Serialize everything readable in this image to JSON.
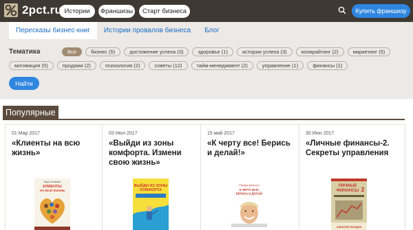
{
  "header": {
    "logo_text": "2pct.ru",
    "nav": [
      "Истории",
      "Франшизы",
      "Старт бизнеса"
    ],
    "buy_label": "Купить франшизу"
  },
  "tabs": [
    {
      "label": "Пересказы бизнес-книг",
      "active": true
    },
    {
      "label": "Истории провалов бизнеса",
      "active": false
    },
    {
      "label": "Блог",
      "active": false
    }
  ],
  "filters": {
    "label": "Тематика",
    "row1": [
      "Все",
      "бизнес (5)",
      "достижение успеха (3)",
      "здоровье (1)",
      "истории успеха (3)",
      "копирайтинг (2)",
      "маркетинг (5)"
    ],
    "row2": [
      "мотивация (5)",
      "продажи (2)",
      "психология (2)",
      "советы (12)",
      "тайм-менеджмент (2)",
      "управление (1)",
      "финансы (1)"
    ],
    "find_label": "Найти"
  },
  "popular": {
    "title": "Популярные",
    "cards": [
      {
        "date": "01 Мар 2017",
        "title": "«Клиенты на всю жизнь»",
        "cover_author": "Карл Сьюэлл",
        "cover_title": "КЛИЕНТЫ НА ВСЮ ЖИЗНЬ"
      },
      {
        "date": "03 Июл 2017",
        "title": "«Выйди из зоны комфорта. Измени свою жизнь»",
        "cover_author": "",
        "cover_title": "ВЫЙДИ ИЗ ЗОНЫ КОМФОРТА"
      },
      {
        "date": "15 май 2017",
        "title": "«К черту все! Берись и делай!»",
        "cover_author": "Ричард Брэнсон",
        "cover_title": "К ЧЕРТУ ВСЕ! БЕРИСЬ И ДЕЛАЙ!"
      },
      {
        "date": "30 Июн 2017",
        "title": "«Личные финансы-2. Секреты управления",
        "cover_author": "АЛЕКСЕЙ ПОКУДОВ",
        "cover_title": "ЛИЧНЫЕ ФИНАНСЫ 2"
      }
    ]
  },
  "colors": {
    "topbar": "#3f3934",
    "accent_blue": "#2f86e0",
    "panel": "#ece9e6",
    "chip_active": "#a28c72",
    "section": "#5b4b3f"
  }
}
